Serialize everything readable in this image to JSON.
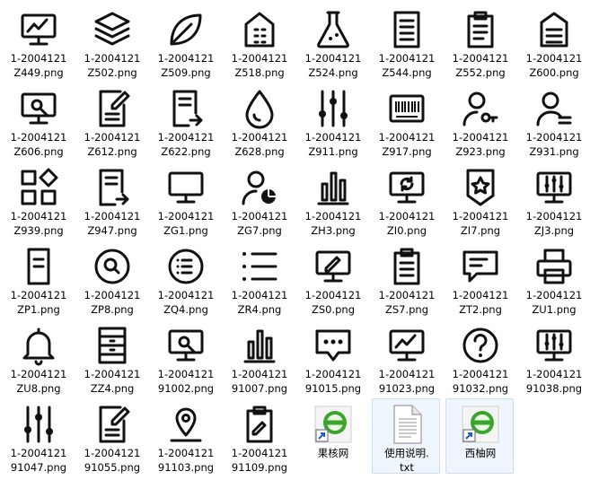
{
  "files": [
    {
      "name": "1-2004121\nZ449.png",
      "icon": "monitor-chart-icon"
    },
    {
      "name": "1-2004121\nZ502.png",
      "icon": "layers-icon"
    },
    {
      "name": "1-2004121\nZ509.png",
      "icon": "leaf-icon"
    },
    {
      "name": "1-2004121\nZ518.png",
      "icon": "building-icon"
    },
    {
      "name": "1-2004121\nZ524.png",
      "icon": "flask-icon"
    },
    {
      "name": "1-2004121\nZ544.png",
      "icon": "document-lines-icon"
    },
    {
      "name": "1-2004121\nZ552.png",
      "icon": "clipboard-icon"
    },
    {
      "name": "1-2004121\nZ600.png",
      "icon": "house-doc-icon"
    },
    {
      "name": "1-2004121\nZ606.png",
      "icon": "monitor-search-icon"
    },
    {
      "name": "1-2004121\nZ612.png",
      "icon": "doc-edit-icon"
    },
    {
      "name": "1-2004121\nZ622.png",
      "icon": "doc-arrow-icon"
    },
    {
      "name": "1-2004121\nZ628.png",
      "icon": "drop-icon"
    },
    {
      "name": "1-2004121\nZ911.png",
      "icon": "sliders-icon"
    },
    {
      "name": "1-2004121\nZ917.png",
      "icon": "barcode-icon"
    },
    {
      "name": "1-2004121\nZ923.png",
      "icon": "user-key-icon"
    },
    {
      "name": "1-2004121\nZ931.png",
      "icon": "user-list-icon"
    },
    {
      "name": "1-2004121\nZ939.png",
      "icon": "apps-icon"
    },
    {
      "name": "1-2004121\nZ947.png",
      "icon": "doc-export-icon"
    },
    {
      "name": "1-2004121\nZG1.png",
      "icon": "monitor-icon"
    },
    {
      "name": "1-2004121\nZG7.png",
      "icon": "user-pie-icon"
    },
    {
      "name": "1-2004121\nZH3.png",
      "icon": "bar-chart-icon"
    },
    {
      "name": "1-2004121\nZI0.png",
      "icon": "monitor-refresh-icon"
    },
    {
      "name": "1-2004121\nZI7.png",
      "icon": "badge-star-icon"
    },
    {
      "name": "1-2004121\nZJ3.png",
      "icon": "monitor-sliders-icon"
    },
    {
      "name": "1-2004121\nZP1.png",
      "icon": "doc-small-icon"
    },
    {
      "name": "1-2004121\nZP8.png",
      "icon": "search-circle-icon"
    },
    {
      "name": "1-2004121\nZQ4.png",
      "icon": "list-circle-icon"
    },
    {
      "name": "1-2004121\nZR4.png",
      "icon": "list-icon"
    },
    {
      "name": "1-2004121\nZS0.png",
      "icon": "monitor-pen-icon"
    },
    {
      "name": "1-2004121\nZS7.png",
      "icon": "clipboard-lines-icon"
    },
    {
      "name": "1-2004121\nZT2.png",
      "icon": "chat-bubble-icon"
    },
    {
      "name": "1-2004121\nZU1.png",
      "icon": "printer-icon"
    },
    {
      "name": "1-2004121\nZU8.png",
      "icon": "bell-icon"
    },
    {
      "name": "1-2004121\nZZ4.png",
      "icon": "cabinet-icon"
    },
    {
      "name": "1-2004121\n91002.png",
      "icon": "monitor-search-icon"
    },
    {
      "name": "1-2004121\n91007.png",
      "icon": "bar-chart-icon"
    },
    {
      "name": "1-2004121\n91015.png",
      "icon": "chat-dots-icon"
    },
    {
      "name": "1-2004121\n91023.png",
      "icon": "monitor-chart-icon"
    },
    {
      "name": "1-2004121\n91032.png",
      "icon": "question-icon"
    },
    {
      "name": "1-2004121\n91038.png",
      "icon": "monitor-sliders-icon"
    },
    {
      "name": "1-2004121\n91047.png",
      "icon": "sliders-icon"
    },
    {
      "name": "1-2004121\n91055.png",
      "icon": "doc-edit-icon"
    },
    {
      "name": "1-2004121\n91103.png",
      "icon": "location-pin-icon"
    },
    {
      "name": "1-2004121\n91109.png",
      "icon": "clipboard-edit-icon"
    },
    {
      "name": "果核网",
      "icon": "web-shortcut-icon",
      "selected": false
    },
    {
      "name": "使用说明.\ntxt",
      "icon": "text-file-icon",
      "selected": true
    },
    {
      "name": "西柚网",
      "icon": "web-shortcut-icon",
      "selected": true
    }
  ],
  "colors": {
    "icon": "#111111",
    "selection_bg": "#eef5fc",
    "selection_border": "#c7dff7",
    "globe_green": "#3aa52b"
  }
}
